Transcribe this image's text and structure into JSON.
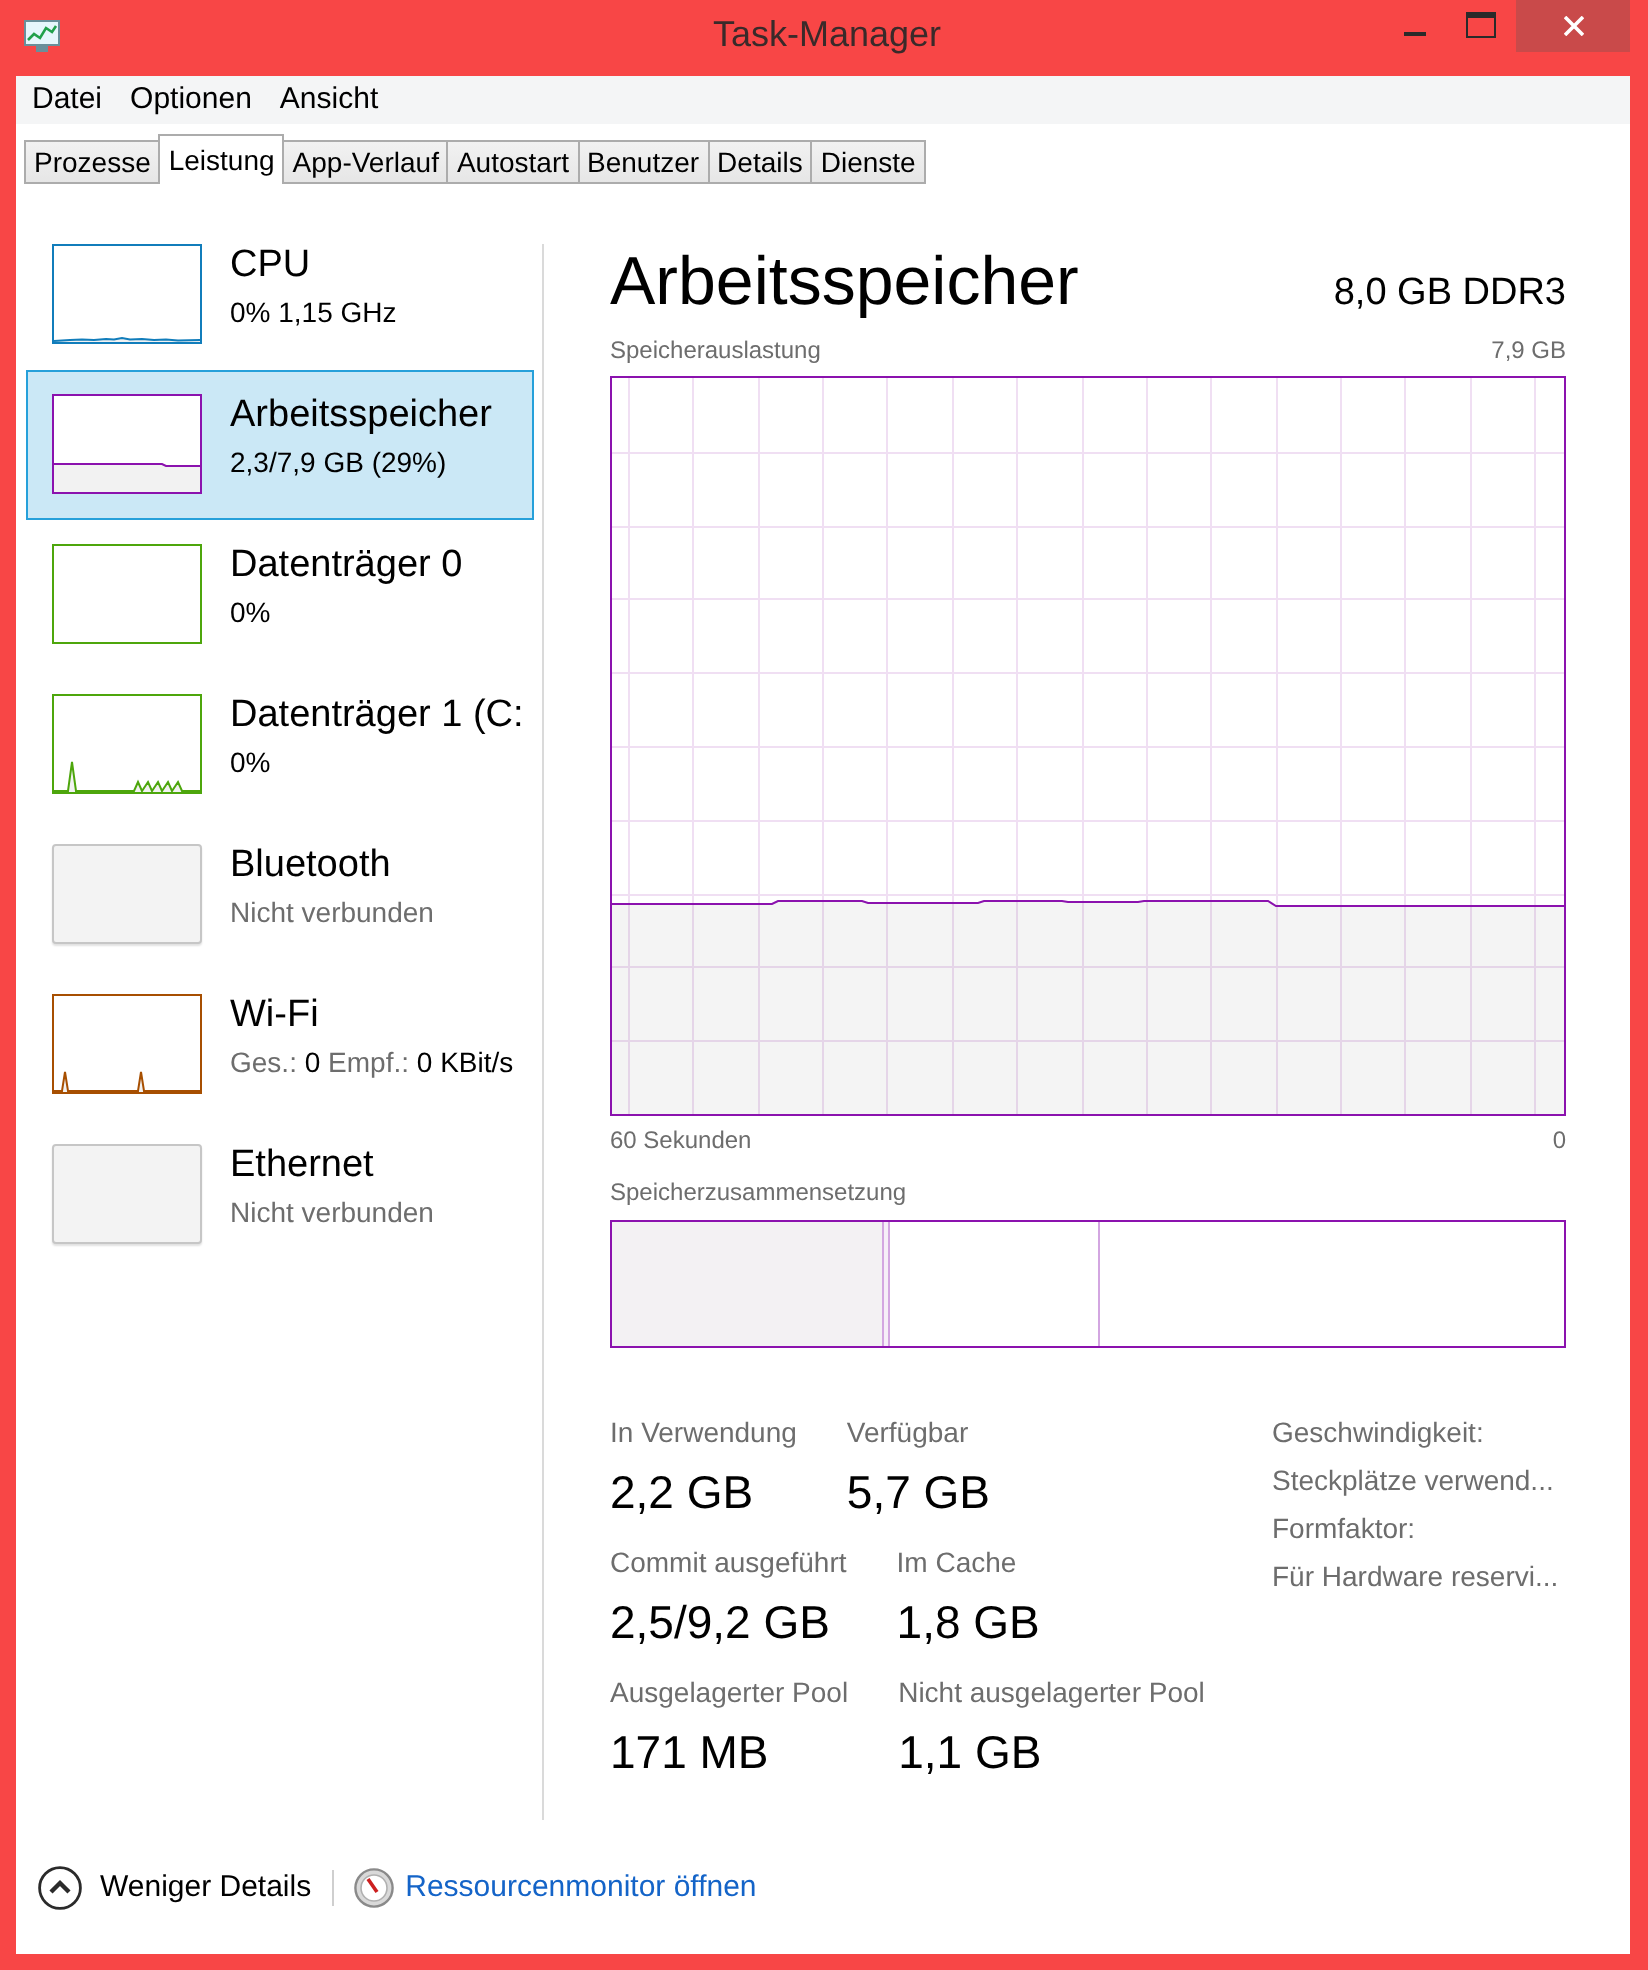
{
  "window": {
    "title": "Task-Manager"
  },
  "menu": [
    "Datei",
    "Optionen",
    "Ansicht"
  ],
  "tabs": [
    {
      "label": "Prozesse",
      "selected": false
    },
    {
      "label": "Leistung",
      "selected": true
    },
    {
      "label": "App-Verlauf",
      "selected": false
    },
    {
      "label": "Autostart",
      "selected": false
    },
    {
      "label": "Benutzer",
      "selected": false
    },
    {
      "label": "Details",
      "selected": false
    },
    {
      "label": "Dienste",
      "selected": false
    }
  ],
  "sidebar": {
    "items": [
      {
        "title": "CPU",
        "subtitle": "0% 1,15 GHz",
        "color": "#117dbb",
        "selected": false,
        "disabled": false
      },
      {
        "title": "Arbeitsspeicher",
        "subtitle": "2,3/7,9 GB (29%)",
        "color": "#8b12ae",
        "selected": true,
        "disabled": false
      },
      {
        "title": "Datenträger 0",
        "subtitle": "0%",
        "color": "#4da60c",
        "selected": false,
        "disabled": false
      },
      {
        "title": "Datenträger 1 (C:",
        "subtitle": "0%",
        "color": "#4da60c",
        "selected": false,
        "disabled": false
      },
      {
        "title": "Bluetooth",
        "subtitle": "Nicht verbunden",
        "selected": false,
        "disabled": true
      },
      {
        "title": "Wi-Fi",
        "readings": [
          {
            "label": "Ges.:",
            "value": "0"
          },
          {
            "label": "Empf.:",
            "value": "0 KBit/s"
          }
        ],
        "color": "#a74f01",
        "selected": false,
        "disabled": false
      },
      {
        "title": "Ethernet",
        "subtitle": "Nicht verbunden",
        "selected": false,
        "disabled": true
      }
    ]
  },
  "detail": {
    "title": "Arbeitsspeicher",
    "spec": "8,0 GB DDR3",
    "usage_chart": {
      "title": "Speicherauslastung",
      "max_label": "7,9 GB",
      "x_start_label": "60 Sekunden",
      "x_end_label": "0"
    },
    "composition": {
      "title": "Speicherzusammensetzung"
    },
    "stats": [
      [
        {
          "label": "In Verwendung",
          "value": "2,2 GB"
        },
        {
          "label": "Verfügbar",
          "value": "5,7 GB"
        }
      ],
      [
        {
          "label": "Commit ausgeführt",
          "value": "2,5/9,2 GB"
        },
        {
          "label": "Im Cache",
          "value": "1,8 GB"
        }
      ],
      [
        {
          "label": "Ausgelagerter Pool",
          "value": "171 MB"
        },
        {
          "label": "Nicht ausgelagerter Pool",
          "value": "1,1 GB"
        }
      ]
    ],
    "properties": [
      "Geschwindigkeit:",
      "Steckplätze verwend...",
      "Formfaktor:",
      "Für Hardware reservi..."
    ]
  },
  "footer": {
    "toggle": "Weniger Details",
    "link": "Ressourcenmonitor öffnen"
  }
}
